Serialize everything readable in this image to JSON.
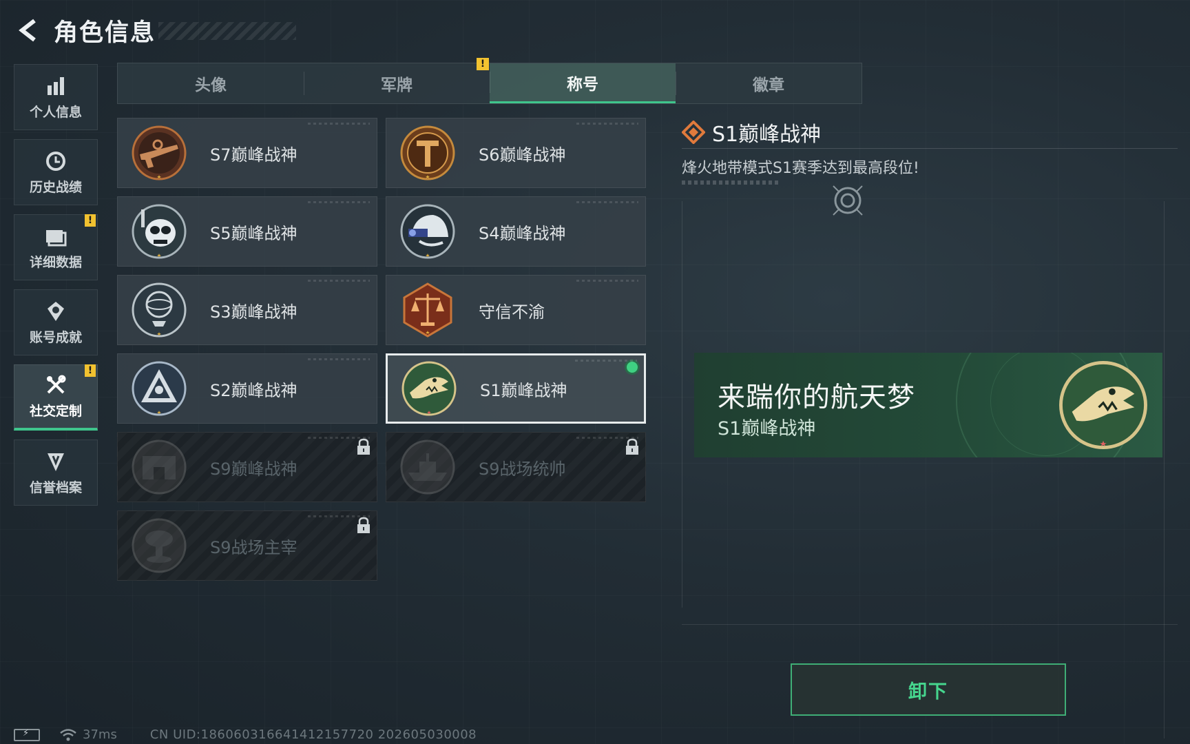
{
  "header": {
    "title": "角色信息"
  },
  "sidebar": {
    "items": [
      {
        "label": "个人信息",
        "icon": "bar-chart-icon",
        "warn": false,
        "active": false
      },
      {
        "label": "历史战绩",
        "icon": "history-clock-icon",
        "warn": false,
        "active": false
      },
      {
        "label": "详细数据",
        "icon": "folder-icon",
        "warn": true,
        "active": false
      },
      {
        "label": "账号成就",
        "icon": "achievement-medal-icon",
        "warn": false,
        "active": false
      },
      {
        "label": "社交定制",
        "icon": "tools-wrench-icon",
        "warn": true,
        "active": true
      },
      {
        "label": "信誉档案",
        "icon": "reputation-shield-icon",
        "warn": false,
        "active": false
      }
    ],
    "warn_mark": "!"
  },
  "tabs": [
    {
      "label": "头像",
      "active": false
    },
    {
      "label": "军牌",
      "active": false,
      "warn": true
    },
    {
      "label": "称号",
      "active": true
    },
    {
      "label": "徽章",
      "active": false
    }
  ],
  "titles": [
    {
      "label": "S7巅峰战神",
      "emblem": "bronze-rifle-emblem",
      "locked": false
    },
    {
      "label": "S6巅峰战神",
      "emblem": "bronze-t-shield-emblem",
      "locked": false
    },
    {
      "label": "S5巅峰战神",
      "emblem": "diver-skull-emblem",
      "locked": false
    },
    {
      "label": "S4巅峰战神",
      "emblem": "night-vision-helmet-emblem",
      "locked": false
    },
    {
      "label": "S3巅峰战神",
      "emblem": "globe-skull-emblem",
      "locked": false
    },
    {
      "label": "守信不渝",
      "emblem": "scales-of-justice-emblem",
      "locked": false
    },
    {
      "label": "S2巅峰战神",
      "emblem": "triangle-skull-emblem",
      "locked": false
    },
    {
      "label": "S1巅峰战神",
      "emblem": "crocodile-emblem",
      "locked": false,
      "selected": true,
      "equipped": true
    },
    {
      "label": "S9巅峰战神",
      "emblem": "fortress-emblem",
      "locked": true
    },
    {
      "label": "S9战场统帅",
      "emblem": "warship-emblem",
      "locked": true
    },
    {
      "label": "S9战场主宰",
      "emblem": "mushroom-cloud-emblem",
      "locked": true
    }
  ],
  "detail": {
    "title": "S1巅峰战神",
    "description": "烽火地带模式S1赛季达到最高段位!",
    "title_icon": "diamond-rank-icon"
  },
  "preview": {
    "main_text": "来踹你的航天梦",
    "sub_text": "S1巅峰战神"
  },
  "actions": {
    "unequip_label": "卸下"
  },
  "footer": {
    "ping": "37ms",
    "uid": "CN UID:1860603166414121577​20 202605030008"
  },
  "colors": {
    "accent_green": "#3fc58c",
    "warn_yellow": "#f2c230",
    "bronze": "#b8703a"
  }
}
